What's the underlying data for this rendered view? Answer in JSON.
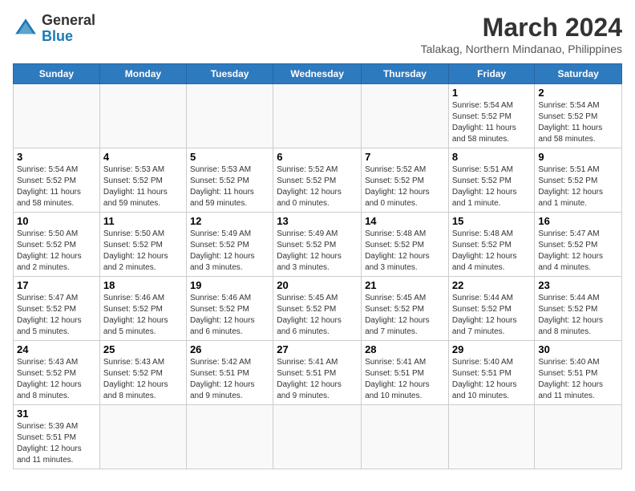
{
  "header": {
    "logo_general": "General",
    "logo_blue": "Blue",
    "title": "March 2024",
    "subtitle": "Talakag, Northern Mindanao, Philippines"
  },
  "weekdays": [
    "Sunday",
    "Monday",
    "Tuesday",
    "Wednesday",
    "Thursday",
    "Friday",
    "Saturday"
  ],
  "weeks": [
    [
      {
        "day": "",
        "info": ""
      },
      {
        "day": "",
        "info": ""
      },
      {
        "day": "",
        "info": ""
      },
      {
        "day": "",
        "info": ""
      },
      {
        "day": "",
        "info": ""
      },
      {
        "day": "1",
        "info": "Sunrise: 5:54 AM\nSunset: 5:52 PM\nDaylight: 11 hours\nand 58 minutes."
      },
      {
        "day": "2",
        "info": "Sunrise: 5:54 AM\nSunset: 5:52 PM\nDaylight: 11 hours\nand 58 minutes."
      }
    ],
    [
      {
        "day": "3",
        "info": "Sunrise: 5:54 AM\nSunset: 5:52 PM\nDaylight: 11 hours\nand 58 minutes."
      },
      {
        "day": "4",
        "info": "Sunrise: 5:53 AM\nSunset: 5:52 PM\nDaylight: 11 hours\nand 59 minutes."
      },
      {
        "day": "5",
        "info": "Sunrise: 5:53 AM\nSunset: 5:52 PM\nDaylight: 11 hours\nand 59 minutes."
      },
      {
        "day": "6",
        "info": "Sunrise: 5:52 AM\nSunset: 5:52 PM\nDaylight: 12 hours\nand 0 minutes."
      },
      {
        "day": "7",
        "info": "Sunrise: 5:52 AM\nSunset: 5:52 PM\nDaylight: 12 hours\nand 0 minutes."
      },
      {
        "day": "8",
        "info": "Sunrise: 5:51 AM\nSunset: 5:52 PM\nDaylight: 12 hours\nand 1 minute."
      },
      {
        "day": "9",
        "info": "Sunrise: 5:51 AM\nSunset: 5:52 PM\nDaylight: 12 hours\nand 1 minute."
      }
    ],
    [
      {
        "day": "10",
        "info": "Sunrise: 5:50 AM\nSunset: 5:52 PM\nDaylight: 12 hours\nand 2 minutes."
      },
      {
        "day": "11",
        "info": "Sunrise: 5:50 AM\nSunset: 5:52 PM\nDaylight: 12 hours\nand 2 minutes."
      },
      {
        "day": "12",
        "info": "Sunrise: 5:49 AM\nSunset: 5:52 PM\nDaylight: 12 hours\nand 3 minutes."
      },
      {
        "day": "13",
        "info": "Sunrise: 5:49 AM\nSunset: 5:52 PM\nDaylight: 12 hours\nand 3 minutes."
      },
      {
        "day": "14",
        "info": "Sunrise: 5:48 AM\nSunset: 5:52 PM\nDaylight: 12 hours\nand 3 minutes."
      },
      {
        "day": "15",
        "info": "Sunrise: 5:48 AM\nSunset: 5:52 PM\nDaylight: 12 hours\nand 4 minutes."
      },
      {
        "day": "16",
        "info": "Sunrise: 5:47 AM\nSunset: 5:52 PM\nDaylight: 12 hours\nand 4 minutes."
      }
    ],
    [
      {
        "day": "17",
        "info": "Sunrise: 5:47 AM\nSunset: 5:52 PM\nDaylight: 12 hours\nand 5 minutes."
      },
      {
        "day": "18",
        "info": "Sunrise: 5:46 AM\nSunset: 5:52 PM\nDaylight: 12 hours\nand 5 minutes."
      },
      {
        "day": "19",
        "info": "Sunrise: 5:46 AM\nSunset: 5:52 PM\nDaylight: 12 hours\nand 6 minutes."
      },
      {
        "day": "20",
        "info": "Sunrise: 5:45 AM\nSunset: 5:52 PM\nDaylight: 12 hours\nand 6 minutes."
      },
      {
        "day": "21",
        "info": "Sunrise: 5:45 AM\nSunset: 5:52 PM\nDaylight: 12 hours\nand 7 minutes."
      },
      {
        "day": "22",
        "info": "Sunrise: 5:44 AM\nSunset: 5:52 PM\nDaylight: 12 hours\nand 7 minutes."
      },
      {
        "day": "23",
        "info": "Sunrise: 5:44 AM\nSunset: 5:52 PM\nDaylight: 12 hours\nand 8 minutes."
      }
    ],
    [
      {
        "day": "24",
        "info": "Sunrise: 5:43 AM\nSunset: 5:52 PM\nDaylight: 12 hours\nand 8 minutes."
      },
      {
        "day": "25",
        "info": "Sunrise: 5:43 AM\nSunset: 5:52 PM\nDaylight: 12 hours\nand 8 minutes."
      },
      {
        "day": "26",
        "info": "Sunrise: 5:42 AM\nSunset: 5:51 PM\nDaylight: 12 hours\nand 9 minutes."
      },
      {
        "day": "27",
        "info": "Sunrise: 5:41 AM\nSunset: 5:51 PM\nDaylight: 12 hours\nand 9 minutes."
      },
      {
        "day": "28",
        "info": "Sunrise: 5:41 AM\nSunset: 5:51 PM\nDaylight: 12 hours\nand 10 minutes."
      },
      {
        "day": "29",
        "info": "Sunrise: 5:40 AM\nSunset: 5:51 PM\nDaylight: 12 hours\nand 10 minutes."
      },
      {
        "day": "30",
        "info": "Sunrise: 5:40 AM\nSunset: 5:51 PM\nDaylight: 12 hours\nand 11 minutes."
      }
    ],
    [
      {
        "day": "31",
        "info": "Sunrise: 5:39 AM\nSunset: 5:51 PM\nDaylight: 12 hours\nand 11 minutes."
      },
      {
        "day": "",
        "info": ""
      },
      {
        "day": "",
        "info": ""
      },
      {
        "day": "",
        "info": ""
      },
      {
        "day": "",
        "info": ""
      },
      {
        "day": "",
        "info": ""
      },
      {
        "day": "",
        "info": ""
      }
    ]
  ]
}
